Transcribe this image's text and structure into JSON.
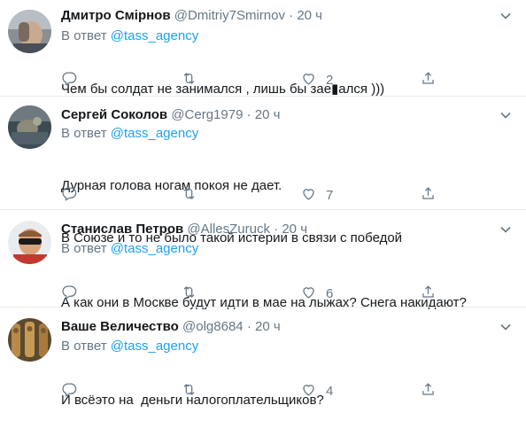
{
  "reply_prefix": "В ответ",
  "tweets": [
    {
      "name": "Дмитро Смірнов",
      "handle": "@Dmitriy7Smirnov",
      "sep": "·",
      "time": "20 ч",
      "mention": "@tass_agency",
      "lines": [
        "Чем бы солдат не занимался , лишь бы зае▮ался )))"
      ],
      "replies": "",
      "retweets": "",
      "likes": "2"
    },
    {
      "name": "Сергей Соколов",
      "handle": "@Cerg1979",
      "sep": "·",
      "time": "20 ч",
      "mention": "@tass_agency",
      "lines": [
        "Дурная голова ногам покоя не дает.",
        "В Союзе и то не было такой истерии в связи с победой"
      ],
      "replies": "",
      "retweets": "",
      "likes": "7"
    },
    {
      "name": "Станислав Петров",
      "handle": "@AllesZuruck",
      "sep": "·",
      "time": "20 ч",
      "mention": "@tass_agency",
      "lines": [
        "А как они в Москве будут идти в мае на лыжах? Снега накидают?"
      ],
      "replies": "",
      "retweets": "",
      "likes": "6"
    },
    {
      "name": "Ваше Величество",
      "handle": "@olg8684",
      "sep": "·",
      "time": "20 ч",
      "mention": "@tass_agency",
      "lines": [
        "И всёэто на  деньги налогоплательщиков?"
      ],
      "replies": "",
      "retweets": "",
      "likes": "4"
    }
  ],
  "icons": {
    "reply": "reply-icon",
    "retweet": "retweet-icon",
    "like": "heart-icon",
    "share": "share-icon",
    "more": "chevron-down-icon"
  },
  "colors": {
    "name": "#14171a",
    "meta": "#657786",
    "link": "#1da1f2",
    "divider": "#e6ecf0"
  }
}
